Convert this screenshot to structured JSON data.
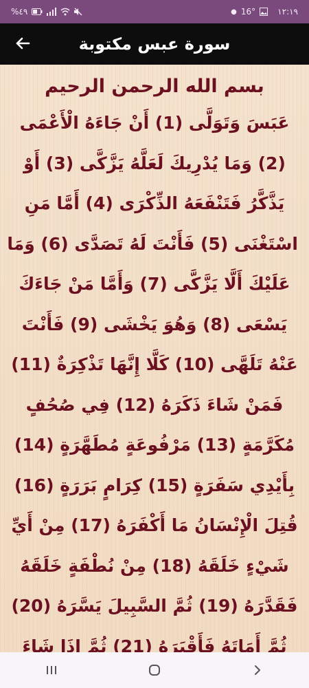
{
  "status_bar": {
    "time": "١٢:١٩",
    "temperature": "16°",
    "battery": "%٤٩"
  },
  "app_bar": {
    "title": "سورة عبس مكتوبة",
    "back_icon": "arrow-left-icon"
  },
  "content": {
    "basmala": "بسم الله الرحمن الرحيم",
    "lines": [
      "عَبَسَ وَتَوَلَّى (1) أَنْ جَاءَهُ الْأَعْمَى",
      "(2) وَمَا يُدْرِيكَ لَعَلَّهُ يَزَّكَّى (3) أَوْ",
      "يَذَّكَّرُ فَتَنْفَعَهُ الذِّكْرَى (4) أَمَّا مَنِ",
      "اسْتَغْنَى (5) فَأَنْتَ لَهُ تَصَدَّى (6) وَمَا",
      "عَلَيْكَ أَلَّا يَزَّكَّى (7) وَأَمَّا مَنْ جَاءَكَ",
      "يَسْعَى (8) وَهُوَ يَخْشَى (9) فَأَنْتَ",
      "عَنْهُ تَلَهَّى (10) كَلَّا إِنَّهَا تَذْكِرَةٌ (11)",
      "فَمَنْ شَاءَ ذَكَرَهُ (12) فِي صُحُفٍ",
      "مُكَرَّمَةٍ (13) مَرْفُوعَةٍ مُطَهَّرَةٍ (14)",
      "بِأَيْدِي سَفَرَةٍ (15) كِرَامٍ بَرَرَةٍ (16)",
      "قُتِلَ الْإِنْسَانُ مَا أَكْفَرَهُ (17) مِنْ أَيِّ",
      "شَيْءٍ خَلَقَهُ (18) مِنْ نُطْفَةٍ خَلَقَهُ",
      "فَقَدَّرَهُ (19) ثُمَّ السَّبِيلَ يَسَّرَهُ (20)",
      "ثُمَّ أَمَاتَهُ فَأَقْبَرَهُ (21) ثُمَّ إِذَا شَاءَ"
    ]
  },
  "nav_bar": {
    "recent_icon": "recent-apps-icon",
    "home_icon": "home-icon",
    "back_icon": "chevron-right-icon"
  },
  "colors": {
    "status_bar_bg": "#7a4a7c",
    "app_bar_bg": "#0d0d0d",
    "page_bg": "#f3dfc9",
    "verse_text": "#6b1020"
  }
}
